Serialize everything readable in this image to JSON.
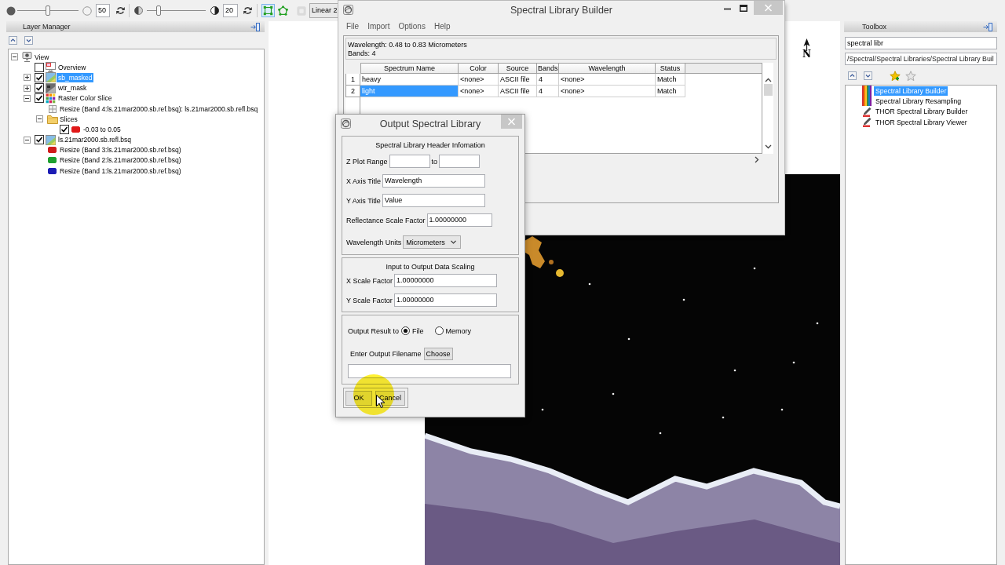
{
  "toolbar": {
    "sliders": [
      {
        "level": 0.5,
        "value": "50"
      },
      {
        "level": 0.2,
        "value": "20"
      }
    ],
    "tools": [
      {
        "kind": "box",
        "selected": true,
        "disabled": false
      },
      {
        "kind": "polygon",
        "selected": false,
        "disabled": false
      },
      {
        "kind": "pan",
        "selected": false,
        "disabled": true
      }
    ],
    "stretch": "Linear 2"
  },
  "layer_manager": {
    "title": "Layer Manager",
    "tree": [
      {
        "label": "View",
        "kind": "view",
        "selected": false,
        "expanded": true,
        "children": [
          {
            "label": "Overview",
            "kind": "overview",
            "checked": false,
            "selected": false
          },
          {
            "label": "sb_masked",
            "kind": "raster",
            "checked": true,
            "selected": true,
            "expanded": false
          },
          {
            "label": "wtr_mask",
            "kind": "mask",
            "checked": true,
            "selected": false,
            "expanded": false
          },
          {
            "label": "Raster Color Slice",
            "kind": "color_slice",
            "checked": true,
            "selected": false,
            "expanded": true,
            "children": [
              {
                "label": "Resize (Band 4:ls.21mar2000.sb.ref.bsq): ls.21mar2000.sb.refl.bsq",
                "kind": "source",
                "selected": false
              },
              {
                "label": "Slices",
                "kind": "folder",
                "selected": false,
                "expanded": true,
                "children": [
                  {
                    "label": "-0.03 to 0.05",
                    "kind": "swatch",
                    "color": "#e01818",
                    "checked": true,
                    "selected": false
                  }
                ]
              }
            ]
          },
          {
            "label": "ls.21mar2000.sb.refl.bsq",
            "kind": "raster",
            "checked": true,
            "selected": false,
            "expanded": true,
            "children": [
              {
                "label": "Resize (Band 3:ls.21mar2000.sb.ref.bsq)",
                "kind": "swatch",
                "color": "#d01c1c",
                "selected": false
              },
              {
                "label": "Resize (Band 2:ls.21mar2000.sb.ref.bsq)",
                "kind": "swatch",
                "color": "#1ea030",
                "selected": false
              },
              {
                "label": "Resize (Band 1:ls.21mar2000.sb.ref.bsq)",
                "kind": "swatch",
                "color": "#1c1cb4",
                "selected": false
              }
            ]
          }
        ]
      }
    ]
  },
  "map_view": {
    "north_label": "N"
  },
  "toolbox": {
    "title": "Toolbox",
    "search": {
      "value": "spectral libr"
    },
    "path": "/Spectral/Spectral Libraries/Spectral Library Buil",
    "items": [
      {
        "label": "Spectral Library Builder",
        "kind": "spectral",
        "selected": true
      },
      {
        "label": "Spectral Library Resampling",
        "kind": "spectral",
        "selected": false
      },
      {
        "label": "THOR Spectral Library Builder",
        "kind": "thor",
        "selected": false
      },
      {
        "label": "THOR Spectral Library Viewer",
        "kind": "thor",
        "selected": false
      }
    ]
  },
  "library_builder": {
    "title": "Spectral Library Builder",
    "menu": [
      "File",
      "Import",
      "Options",
      "Help"
    ],
    "summary": [
      "Wavelength: 0.48 to 0.83 Micrometers",
      "Bands: 4"
    ],
    "table": {
      "columns": [
        "Spectrum Name",
        "Color",
        "Source",
        "Bands",
        "Wavelength",
        "Status"
      ],
      "rows": [
        {
          "number": "1",
          "cells": [
            "heavy",
            "<none>",
            "ASCII file",
            "4",
            "<none>",
            "Match"
          ],
          "selected": false
        },
        {
          "number": "2",
          "cells": [
            "light",
            "<none>",
            "ASCII file",
            "4",
            "<none>",
            "Match"
          ],
          "selected": true
        }
      ]
    }
  },
  "output_dialog": {
    "title": "Output Spectral Library",
    "groups": [
      {
        "title": "Spectral Library Header Infomation",
        "fields": [
          {
            "kind": "range",
            "label": "Z Plot Range",
            "separator": "to"
          },
          {
            "kind": "text",
            "label": "X Axis Title",
            "value": "Wavelength"
          },
          {
            "kind": "text",
            "label": "Y Axis Title",
            "value": "Value"
          },
          {
            "kind": "text",
            "label": "Reflectance Scale Factor",
            "value": "1.00000000"
          },
          {
            "kind": "dropdown",
            "label": "Wavelength Units",
            "value": "Micrometers"
          }
        ]
      },
      {
        "title": "Input to Output Data Scaling",
        "fields": [
          {
            "kind": "text",
            "label": "X Scale Factor",
            "value": "1.00000000"
          },
          {
            "kind": "text",
            "label": "Y Scale Factor",
            "value": "1.00000000"
          }
        ]
      },
      {
        "fields": [
          {
            "kind": "radio",
            "label": "Output Result to",
            "options": [
              {
                "label": "File",
                "selected": true
              },
              {
                "label": "Memory",
                "selected": false
              }
            ]
          },
          {
            "kind": "file",
            "label": "Enter Output Filename",
            "button": "Choose"
          }
        ]
      }
    ],
    "buttons": [
      "OK",
      "Cancel"
    ]
  }
}
